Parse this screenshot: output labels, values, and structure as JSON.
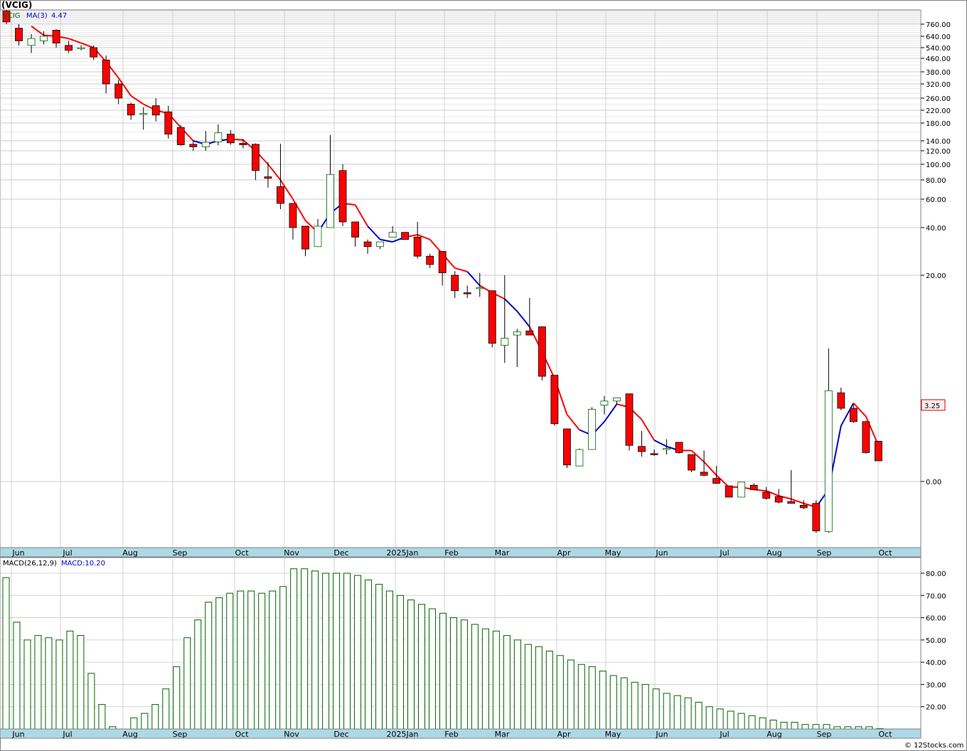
{
  "header": {
    "symbol_title": "(VCIG)"
  },
  "legend": {
    "symbol": "VCIG",
    "ma_label": "MA(3)",
    "ma_value": "4.47",
    "macd_label": "MACD(26,12,9)",
    "macd_value_label": "MACD:10.20"
  },
  "last_price_tag": "3.25",
  "footer": {
    "credit": "© 12Stocks.com"
  },
  "colors": {
    "down_candle": "#ff0000",
    "up_candle_border": "#006400",
    "ma_down": "#ff0000",
    "ma_up": "#0000cc",
    "macd_bar": "#006400",
    "axis_strip": "#add8e6",
    "grid": "#c8c8c8"
  },
  "chart_data": [
    {
      "type": "candlestick",
      "title": "(VCIG)",
      "y_ticks": [
        "760.00",
        "640.00",
        "540.00",
        "460.00",
        "380.00",
        "320.00",
        "260.00",
        "220.00",
        "180.00",
        "140.00",
        "120.00",
        "100.00",
        "80.00",
        "60.00",
        "40.00",
        "20.00",
        "0.00"
      ],
      "x_months": [
        "Jun",
        "Jul",
        "Aug",
        "Sep",
        "Oct",
        "Nov",
        "Dec",
        "2025Jan",
        "Feb",
        "Mar",
        "Apr",
        "May",
        "Jun",
        "Jul",
        "Aug",
        "Sep",
        "Oct"
      ],
      "ma_period": 3,
      "last_price": 3.25,
      "candles": [
        {
          "o": 990,
          "h": 1010,
          "l": 760,
          "c": 800
        },
        {
          "o": 720,
          "h": 760,
          "l": 560,
          "c": 600
        },
        {
          "o": 560,
          "h": 660,
          "l": 500,
          "c": 620
        },
        {
          "o": 600,
          "h": 690,
          "l": 570,
          "c": 640
        },
        {
          "o": 700,
          "h": 710,
          "l": 540,
          "c": 580
        },
        {
          "o": 560,
          "h": 600,
          "l": 500,
          "c": 520
        },
        {
          "o": 540,
          "h": 560,
          "l": 520,
          "c": 540
        },
        {
          "o": 540,
          "h": 560,
          "l": 450,
          "c": 470
        },
        {
          "o": 450,
          "h": 480,
          "l": 280,
          "c": 320
        },
        {
          "o": 320,
          "h": 340,
          "l": 240,
          "c": 260
        },
        {
          "o": 240,
          "h": 245,
          "l": 190,
          "c": 205
        },
        {
          "o": 210,
          "h": 230,
          "l": 165,
          "c": 210
        },
        {
          "o": 235,
          "h": 260,
          "l": 185,
          "c": 205
        },
        {
          "o": 215,
          "h": 235,
          "l": 145,
          "c": 155
        },
        {
          "o": 170,
          "h": 175,
          "l": 130,
          "c": 132
        },
        {
          "o": 133,
          "h": 140,
          "l": 120,
          "c": 128
        },
        {
          "o": 128,
          "h": 162,
          "l": 120,
          "c": 137
        },
        {
          "o": 138,
          "h": 177,
          "l": 131,
          "c": 158
        },
        {
          "o": 155,
          "h": 164,
          "l": 132,
          "c": 136
        },
        {
          "o": 135,
          "h": 144,
          "l": 125,
          "c": 132
        },
        {
          "o": 133,
          "h": 135,
          "l": 80,
          "c": 92
        },
        {
          "o": 84,
          "h": 103,
          "l": 72,
          "c": 82
        },
        {
          "o": 73,
          "h": 134,
          "l": 53,
          "c": 57
        },
        {
          "o": 57,
          "h": 57,
          "l": 35,
          "c": 40
        },
        {
          "o": 41,
          "h": 41,
          "l": 28,
          "c": 31
        },
        {
          "o": 32,
          "h": 46,
          "l": 32,
          "c": 41
        },
        {
          "o": 40,
          "h": 153,
          "l": 40,
          "c": 87
        },
        {
          "o": 92,
          "h": 100,
          "l": 41,
          "c": 44
        },
        {
          "o": 44,
          "h": 44,
          "l": 32,
          "c": 36
        },
        {
          "o": 34,
          "h": 35,
          "l": 29,
          "c": 32
        },
        {
          "o": 32,
          "h": 34,
          "l": 31,
          "c": 34
        },
        {
          "o": 36,
          "h": 41,
          "l": 36,
          "c": 38
        },
        {
          "o": 38,
          "h": 38,
          "l": 35,
          "c": 35
        },
        {
          "o": 36,
          "h": 44,
          "l": 27,
          "c": 28
        },
        {
          "o": 28,
          "h": 29,
          "l": 23,
          "c": 24.5
        },
        {
          "o": 30,
          "h": 30,
          "l": 19,
          "c": 21
        },
        {
          "o": 20,
          "h": 21.7,
          "l": 17.8,
          "c": 18.5
        },
        {
          "o": 18.3,
          "h": 19,
          "l": 17.8,
          "c": 18.2
        },
        {
          "o": 18.8,
          "h": 21,
          "l": 17.9,
          "c": 18.8
        },
        {
          "o": 18.5,
          "h": 18.5,
          "l": 13,
          "c": 13.4
        },
        {
          "o": 13.2,
          "h": 20,
          "l": 11.5,
          "c": 13.9
        },
        {
          "o": 14.2,
          "h": 14.8,
          "l": 11.1,
          "c": 14.5
        },
        {
          "o": 14.6,
          "h": 17.8,
          "l": 14.3,
          "c": 14.2
        },
        {
          "o": 15,
          "h": 15,
          "l": 9.8,
          "c": 10.2
        },
        {
          "o": 10.3,
          "h": 10.3,
          "l": 5.4,
          "c": 5.6
        },
        {
          "o": 5.1,
          "h": 5.1,
          "l": 1.3,
          "c": 1.6
        },
        {
          "o": 1.5,
          "h": 3.2,
          "l": 1.6,
          "c": 3.1
        },
        {
          "o": 3.1,
          "h": 7.2,
          "l": 3.2,
          "c": 7
        },
        {
          "o": 7.4,
          "h": 8.3,
          "l": 6.5,
          "c": 7.8
        },
        {
          "o": 7.8,
          "h": 8.1,
          "l": 7.5,
          "c": 8.1
        },
        {
          "o": 8.5,
          "h": 8.5,
          "l": 3,
          "c": 3.5
        },
        {
          "o": 3.4,
          "h": 4.9,
          "l": 2.4,
          "c": 2.9
        },
        {
          "o": 2.7,
          "h": 3.1,
          "l": 2.5,
          "c": 2.6
        },
        {
          "o": 3.1,
          "h": 4.1,
          "l": 2.6,
          "c": 3.2
        },
        {
          "o": 3.8,
          "h": 3.8,
          "l": 2.7,
          "c": 2.8
        },
        {
          "o": 2.6,
          "h": 2.6,
          "l": 0.9,
          "c": 1.1
        },
        {
          "o": 0.9,
          "h": 3.0,
          "l": 0.5,
          "c": 0.6
        },
        {
          "o": 0.3,
          "h": 1.5,
          "l": -0.4,
          "c": -0.3
        },
        {
          "o": -0.7,
          "h": -0.7,
          "l": -2.2,
          "c": -2.5
        },
        {
          "o": -2.5,
          "h": -0.2,
          "l": -0.1,
          "c": -0.1
        },
        {
          "o": -0.6,
          "h": -0.3,
          "l": -1.2,
          "c": -1.3
        },
        {
          "o": -1.7,
          "h": -0.9,
          "l": -2.9,
          "c": -2.7
        },
        {
          "o": -2.4,
          "h": -1.2,
          "l": -3.5,
          "c": -3.3
        },
        {
          "o": -3.2,
          "h": 1.1,
          "l": -3.4,
          "c": -3.5
        },
        {
          "o": -3.8,
          "h": -3.0,
          "l": -4.4,
          "c": -4.2
        },
        {
          "o": -3.5,
          "h": -3.0,
          "l": -8.2,
          "c": -7.9
        },
        {
          "o": -8.0,
          "h": 12.9,
          "l": -8.2,
          "c": 8.8
        },
        {
          "o": 8.6,
          "h": 9.1,
          "l": 6.9,
          "c": 7.1
        },
        {
          "o": 7.1,
          "h": 7.5,
          "l": 5.7,
          "c": 5.8
        },
        {
          "o": 5.8,
          "h": 5.9,
          "l": 2.7,
          "c": 2.8
        },
        {
          "o": 3.9,
          "h": 3.9,
          "l": 2.0,
          "c": 2.0
        }
      ],
      "ma": [
        null,
        null,
        740,
        650,
        640,
        620,
        580,
        540,
        440,
        350,
        270,
        240,
        220,
        210,
        170,
        140,
        133,
        140,
        144,
        142,
        120,
        100,
        80,
        60,
        45,
        38,
        50,
        57,
        56,
        41,
        35,
        34,
        36,
        37,
        35,
        29,
        23,
        21.5,
        19,
        18.3,
        17.7,
        16.5,
        15,
        12.6,
        10,
        6.5,
        5,
        4.5,
        5.8,
        7.5,
        7.2,
        6,
        4,
        3.4,
        3,
        3,
        1.9,
        0.6,
        -0.9,
        -0.9,
        -1.3,
        -1.5,
        -2.3,
        -2.8,
        -3.5,
        -4.1,
        -1.3,
        5.4,
        7.6,
        6.3,
        3.5
      ],
      "ma_up": [
        false,
        false,
        false,
        false,
        false,
        false,
        false,
        false,
        false,
        false,
        false,
        false,
        false,
        false,
        false,
        false,
        true,
        true,
        true,
        false,
        false,
        false,
        false,
        false,
        false,
        false,
        true,
        true,
        false,
        false,
        true,
        true,
        true,
        false,
        false,
        false,
        false,
        false,
        true,
        false,
        false,
        true,
        true,
        false,
        false,
        false,
        false,
        true,
        true,
        true,
        false,
        false,
        false,
        true,
        true,
        false,
        false,
        false,
        false,
        false,
        false,
        false,
        false,
        false,
        false,
        false,
        true,
        true,
        true,
        false,
        false
      ]
    },
    {
      "type": "bar",
      "title": "MACD(26,12,9)",
      "y_ticks": [
        "80.00",
        "70.00",
        "60.00",
        "50.00",
        "40.00",
        "30.00",
        "20.00"
      ],
      "x_months": [
        "Jun",
        "Jul",
        "Aug",
        "Sep",
        "Oct",
        "Nov",
        "Dec",
        "2025Jan",
        "Feb",
        "Mar",
        "Apr",
        "May",
        "Jun",
        "Jul",
        "Aug",
        "Sep",
        "Oct"
      ],
      "values": [
        78,
        58,
        50,
        52,
        51,
        50,
        54,
        52,
        35,
        21,
        11,
        10,
        15,
        17,
        21,
        28,
        38,
        51,
        59,
        67,
        69,
        71,
        72,
        72,
        71,
        72,
        74,
        82,
        82,
        81,
        80,
        80,
        80,
        79,
        77,
        75,
        72,
        70,
        68,
        66,
        64,
        62,
        60,
        59,
        57,
        55,
        54,
        52,
        50,
        48,
        47,
        45,
        43,
        41,
        39,
        38,
        36,
        34,
        33,
        31,
        30,
        28,
        26,
        25,
        24,
        22,
        20,
        19,
        18,
        17,
        16,
        15,
        14,
        13,
        13,
        12,
        12,
        12,
        11,
        11,
        11,
        11,
        10.2
      ]
    }
  ]
}
